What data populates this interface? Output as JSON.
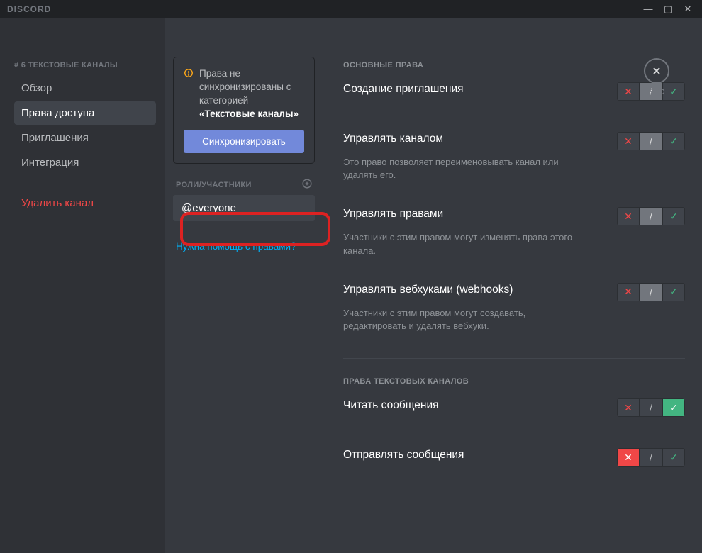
{
  "brand": "DISCORD",
  "esc_label": "ESC",
  "channel_crumb_prefix": "# 6",
  "channel_crumb_name": "ТЕКСТОВЫЕ КАНАЛЫ",
  "nav": {
    "overview": "Обзор",
    "permissions": "Права доступа",
    "invites": "Приглашения",
    "integration": "Интеграция",
    "delete": "Удалить канал"
  },
  "sync": {
    "text_1": "Права не синхронизированы с категорией",
    "text_2": "«Текстовые каналы»",
    "button": "Синхронизировать"
  },
  "roles_header": "РОЛИ/УЧАСТНИКИ",
  "role_everyone": "@everyone",
  "help_link": "Нужна помощь с правами?",
  "sections": {
    "general": "ОСНОВНЫЕ ПРАВА",
    "text": "ПРАВА ТЕКСТОВЫХ КАНАЛОВ"
  },
  "perms": {
    "create_invite": {
      "title": "Создание приглашения",
      "state": "neutral"
    },
    "manage_channel": {
      "title": "Управлять каналом",
      "desc": "Это право позволяет переименовывать канал или удалять его.",
      "state": "neutral"
    },
    "manage_perms": {
      "title": "Управлять правами",
      "desc": "Участники с этим правом могут изменять права этого канала.",
      "state": "neutral"
    },
    "manage_webhooks": {
      "title": "Управлять вебхуками (webhooks)",
      "desc": "Участники с этим правом могут создавать, редактировать и удалять вебхуки.",
      "state": "neutral"
    },
    "read_messages": {
      "title": "Читать сообщения",
      "state": "allow"
    },
    "send_messages": {
      "title": "Отправлять сообщения",
      "state": "deny"
    }
  },
  "glyph": {
    "x": "✕",
    "slash": "/",
    "check": "✓",
    "plus": "+"
  }
}
